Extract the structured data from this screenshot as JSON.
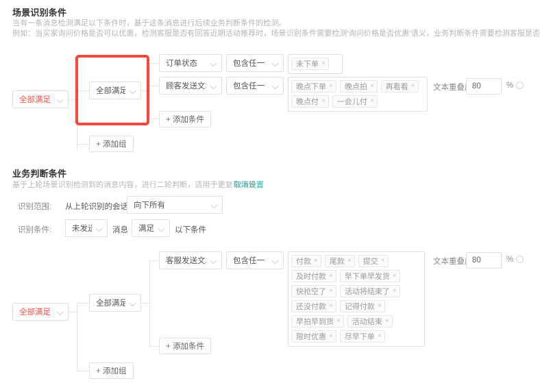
{
  "section1": {
    "title": "场景识别条件",
    "desc_line1": "当有一条消息检测满足以下条件时，基于这条消息进行后续业务判断条件的检测。",
    "desc_line2": "例如：当买家询问价格是否可以优惠，检测客服是否有回答近期活动推荐时，场景识别条件需要检测'询问价格是否优惠'语义，业务判断条件需要检测客服是否发送活动推荐话术。",
    "root_select": "全部满足",
    "group_select": "全部满足",
    "rows": [
      {
        "field": "订单状态",
        "operator": "包含任一",
        "tags": [
          "未下单"
        ]
      },
      {
        "field": "顾客发送文本",
        "operator": "包含任一",
        "tags": [
          "晚点下单",
          "晚点拍",
          "再看看",
          "晚点付",
          "一会儿付"
        ],
        "overlap_label": "文本重叠度",
        "overlap_value": "80",
        "overlap_unit": "%"
      }
    ],
    "add_condition": "添加条件",
    "add_group": "添加组"
  },
  "section2": {
    "title": "业务判断条件",
    "desc": "基于上轮场景识别检测到的消息内容，进行二轮判断，适用于更复杂场景",
    "cancel_link": "取消设置",
    "scope_label": "识别范围:",
    "scope_text": "从上轮识别的会话消息",
    "scope_select": "向下所有",
    "cond_label": "识别条件:",
    "cond_select_1": "未发送",
    "cond_mid_text": "消息",
    "cond_select_2": "满足",
    "cond_suffix_text": "以下条件",
    "root_select": "全部满足",
    "group_select": "全部满足",
    "rows": [
      {
        "field": "客服发送文本",
        "operator": "包含任一",
        "tags": [
          "付款",
          "尾款",
          "提交",
          "及时付款",
          "早下单早发货",
          "快抢空了",
          "活动将结束了",
          "还没付款",
          "记得付款",
          "早拍早到货",
          "活动结束",
          "限时优惠",
          "尽早下单"
        ],
        "overlap_label": "文本重叠度",
        "overlap_value": "80",
        "overlap_unit": "%"
      }
    ],
    "add_condition": "添加条件",
    "add_group": "添加组"
  },
  "colors": {
    "accent_red": "#fb4a3f",
    "annotation_red": "#f5483c",
    "link_teal": "#2fb7b0",
    "border": "#e0e0e0"
  }
}
